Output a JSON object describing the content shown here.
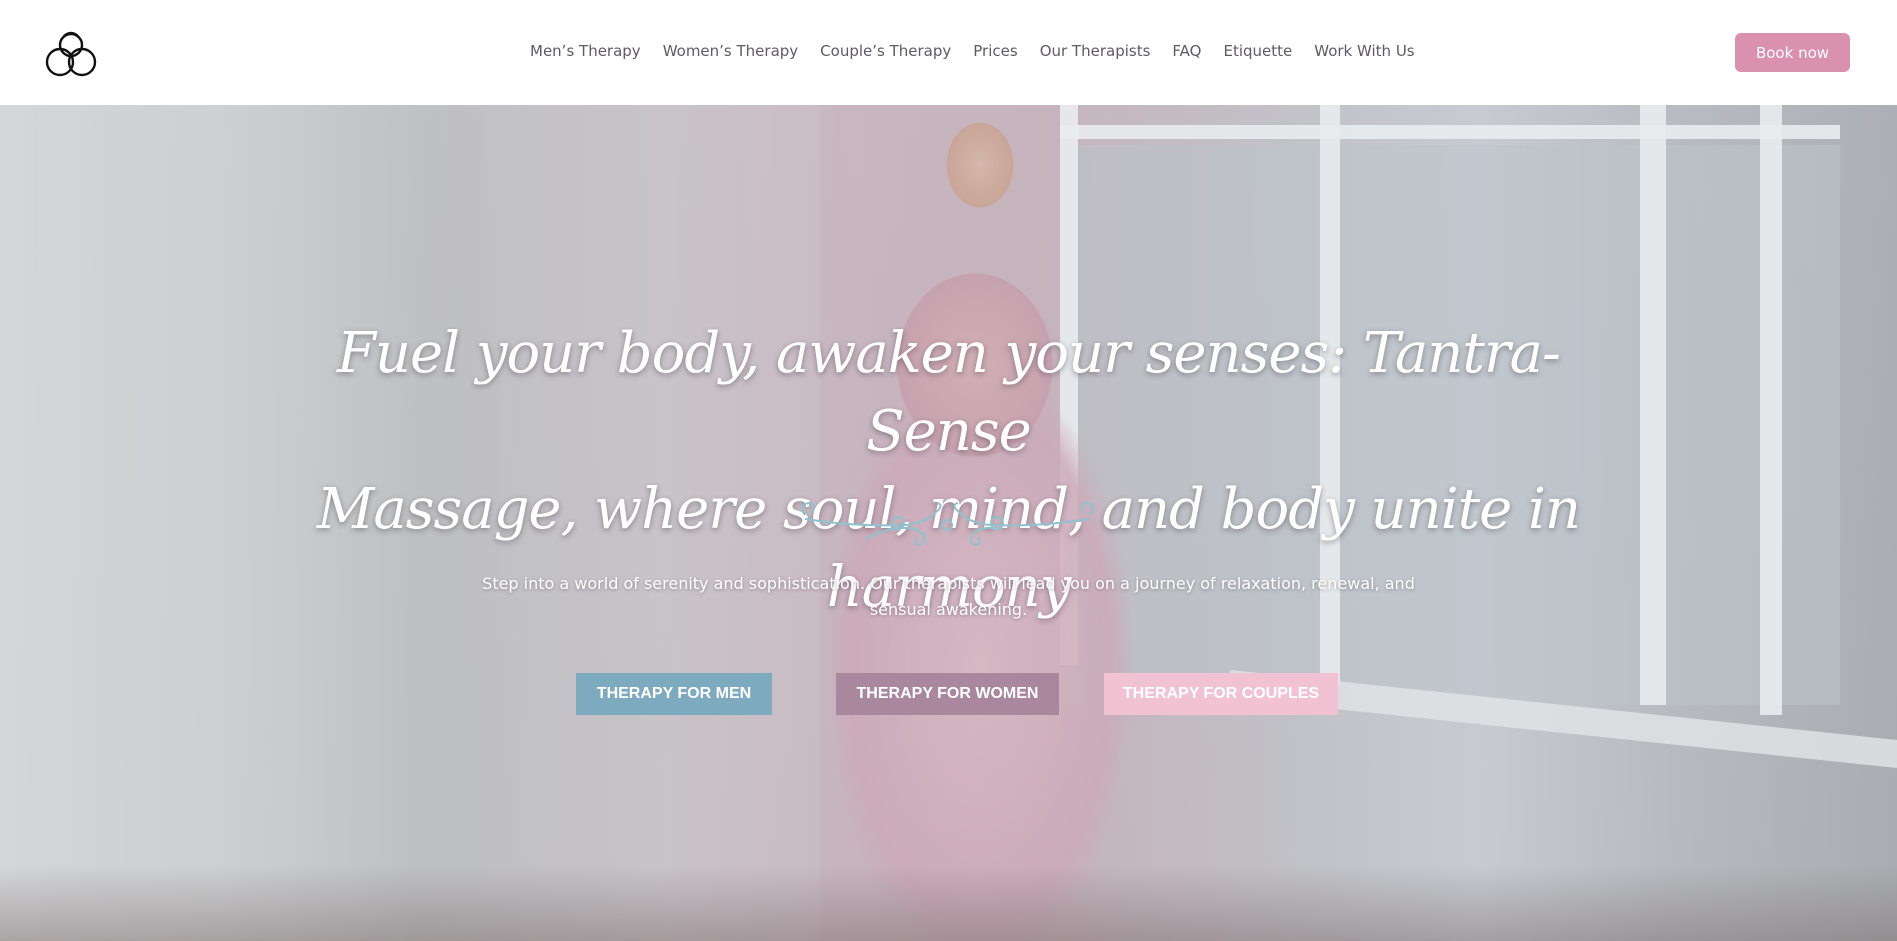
{
  "header": {
    "logo_name": "intertwined-circles-logo",
    "nav": [
      {
        "label": "Men’s Therapy"
      },
      {
        "label": "Women’s Therapy"
      },
      {
        "label": "Couple’s Therapy"
      },
      {
        "label": "Prices"
      },
      {
        "label": "Our Therapists"
      },
      {
        "label": "FAQ"
      },
      {
        "label": "Etiquette"
      },
      {
        "label": "Work With Us"
      }
    ],
    "book_label": "Book now"
  },
  "hero": {
    "headline_line1": "Fuel your body, awaken your senses: Tantra-Sense",
    "headline_line2": "Massage, where soul, mind, and body unite in harmony",
    "subtext": "Step into a world of serenity and sophistication. Our therapists will lead you on a journey of relaxation, renewal, and sensual awakening.",
    "buttons": [
      {
        "label": "THERAPY FOR MEN"
      },
      {
        "label": "THERAPY FOR WOMEN"
      },
      {
        "label": "THERAPY FOR COUPLES"
      }
    ]
  },
  "colors": {
    "book_button": "#d991ad",
    "men_button": "#7eaabf",
    "women_button": "#a9879c",
    "couples_button": "#f1c3d2",
    "divider_ornament": "#8fc2cf"
  }
}
